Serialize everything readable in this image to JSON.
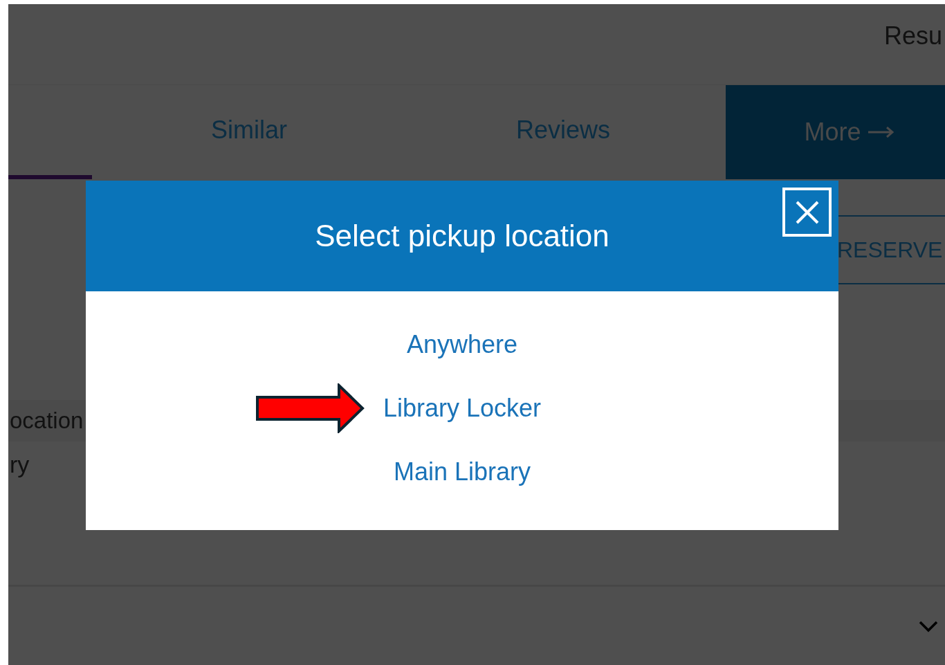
{
  "header": {
    "title": "Resu"
  },
  "tabs": [
    {
      "selected": true
    },
    {
      "label": "Similar",
      "selected": false
    },
    {
      "label": "Reviews",
      "selected": false
    }
  ],
  "more_button": {
    "label": "More"
  },
  "reserve_button": {
    "label": "RESERVE"
  },
  "location_section": {
    "heading": "ocation",
    "value": "ry"
  },
  "dialog": {
    "title": "Select pickup location",
    "options": [
      {
        "label": "Anywhere",
        "pointed": false
      },
      {
        "label": "Library Locker",
        "pointed": true
      },
      {
        "label": "Main Library",
        "pointed": false
      }
    ]
  }
}
